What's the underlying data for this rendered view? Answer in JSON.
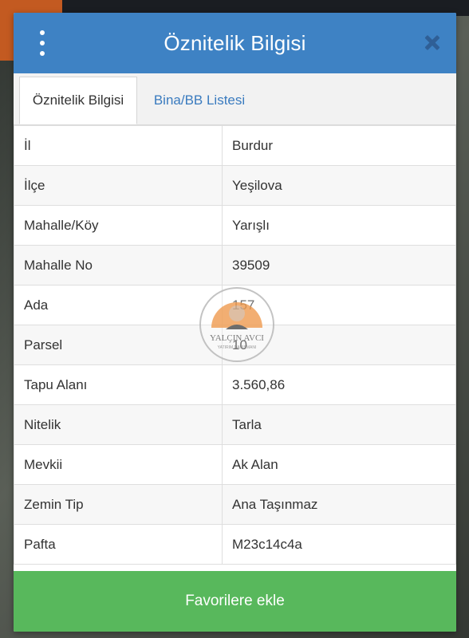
{
  "dialog": {
    "title": "Öznitelik Bilgisi",
    "menu_icon": "kebab-menu-icon",
    "close_icon": "close-icon"
  },
  "tabs": [
    {
      "label": "Öznitelik Bilgisi",
      "active": true
    },
    {
      "label": "Bina/BB Listesi",
      "active": false
    }
  ],
  "attributes": [
    {
      "key": "İl",
      "value": "Burdur"
    },
    {
      "key": "İlçe",
      "value": "Yeşilova"
    },
    {
      "key": "Mahalle/Köy",
      "value": "Yarışlı"
    },
    {
      "key": "Mahalle No",
      "value": "39509"
    },
    {
      "key": "Ada",
      "value": "157"
    },
    {
      "key": "Parsel",
      "value": "10"
    },
    {
      "key": "Tapu Alanı",
      "value": "3.560,86"
    },
    {
      "key": "Nitelik",
      "value": "Tarla"
    },
    {
      "key": "Mevkii",
      "value": "Ak Alan"
    },
    {
      "key": "Zemin Tip",
      "value": "Ana Taşınmaz"
    },
    {
      "key": "Pafta",
      "value": "M23c14c4a"
    }
  ],
  "watermark": {
    "line1": "YALÇIN AVCI",
    "line2": "YATIRIM DANIŞMANI"
  },
  "footer": {
    "favorite_label": "Favorilere ekle"
  },
  "colors": {
    "header": "#3e82c4",
    "tab_link": "#3a7bbf",
    "favorite_button": "#58b85c",
    "close_icon": "#2f5f96"
  }
}
